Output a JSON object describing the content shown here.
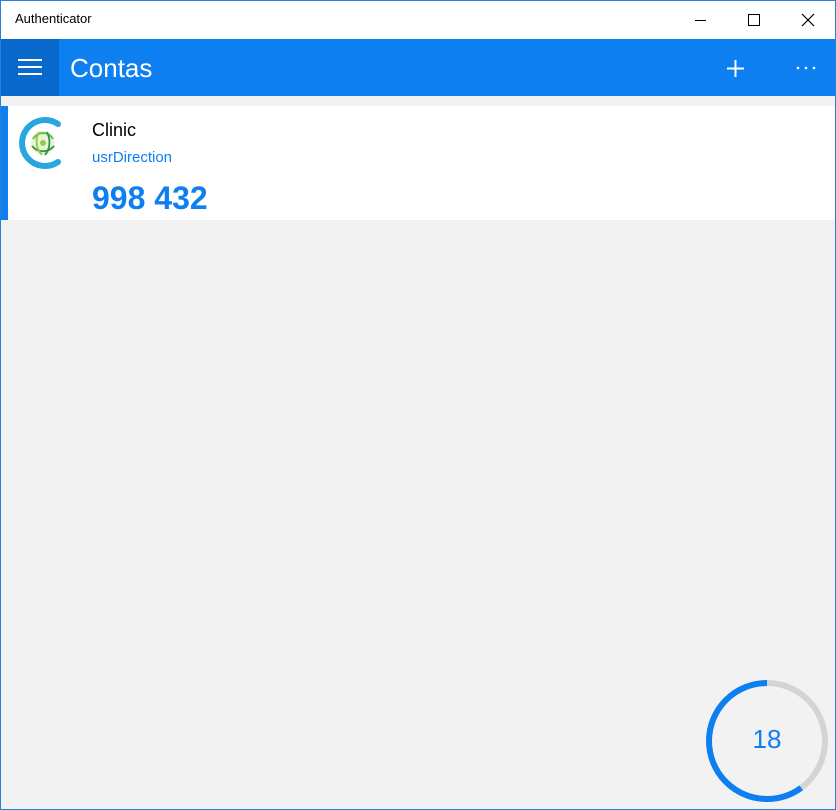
{
  "window": {
    "title": "Authenticator"
  },
  "header": {
    "title": "Contas",
    "menu_icon": "hamburger-icon",
    "add_icon": "plus-icon",
    "more_icon": "ellipsis-icon",
    "accent_color": "#0e7ff0"
  },
  "accounts": [
    {
      "name": "Clinic",
      "username": "usrDirection",
      "code": "998 432",
      "logo_icon": "clinic-logo-icon"
    }
  ],
  "timer": {
    "seconds_remaining": "18",
    "progress_fraction": 0.6
  }
}
